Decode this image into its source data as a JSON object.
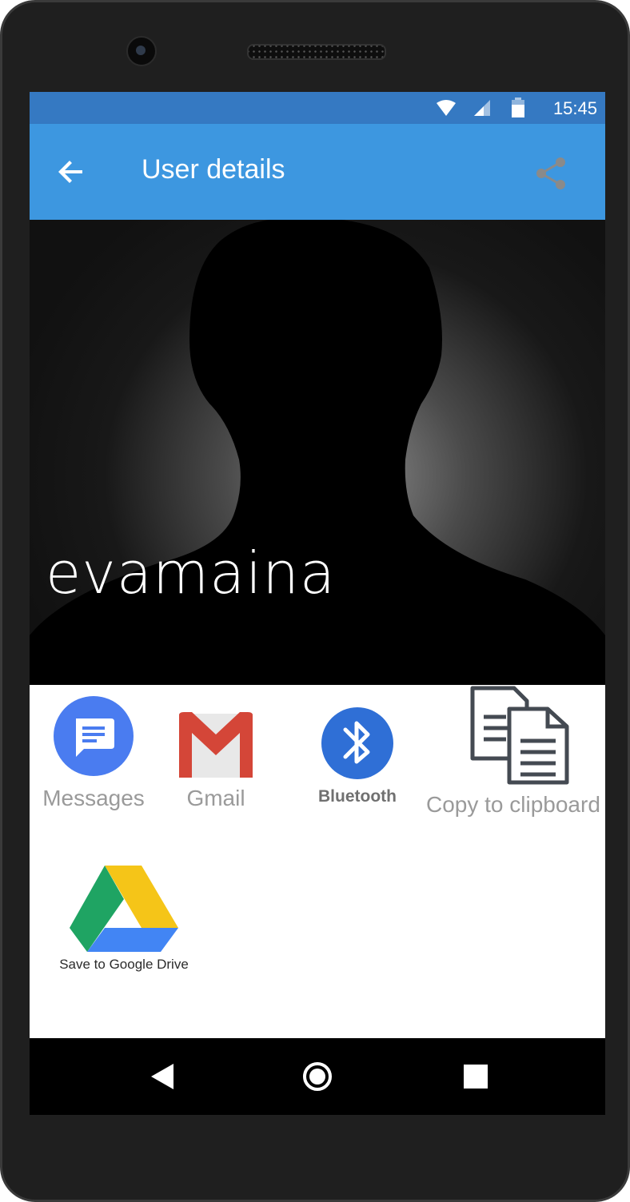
{
  "status_bar": {
    "time": "15:45",
    "icons": [
      "wifi-icon",
      "cellular-signal-icon",
      "battery-icon"
    ]
  },
  "app_bar": {
    "title": "User details",
    "back_icon": "arrow-back-icon",
    "share_icon": "share-icon",
    "color": "#3d97e0"
  },
  "profile": {
    "username": "evamaina"
  },
  "share_targets": [
    {
      "label": "Messages",
      "icon": "messages-icon",
      "color": "#4a7cf0"
    },
    {
      "label": "Gmail",
      "icon": "gmail-icon",
      "color": "#d44638"
    },
    {
      "label": "Bluetooth",
      "icon": "bluetooth-icon",
      "color": "#2f6fd6"
    },
    {
      "label": "Copy to clipboard",
      "icon": "clipboard-icon"
    },
    {
      "label": "Save to Google Drive",
      "icon": "google-drive-icon"
    }
  ],
  "navigation": {
    "back": "nav-back-icon",
    "home": "nav-home-icon",
    "recents": "nav-recents-icon"
  }
}
